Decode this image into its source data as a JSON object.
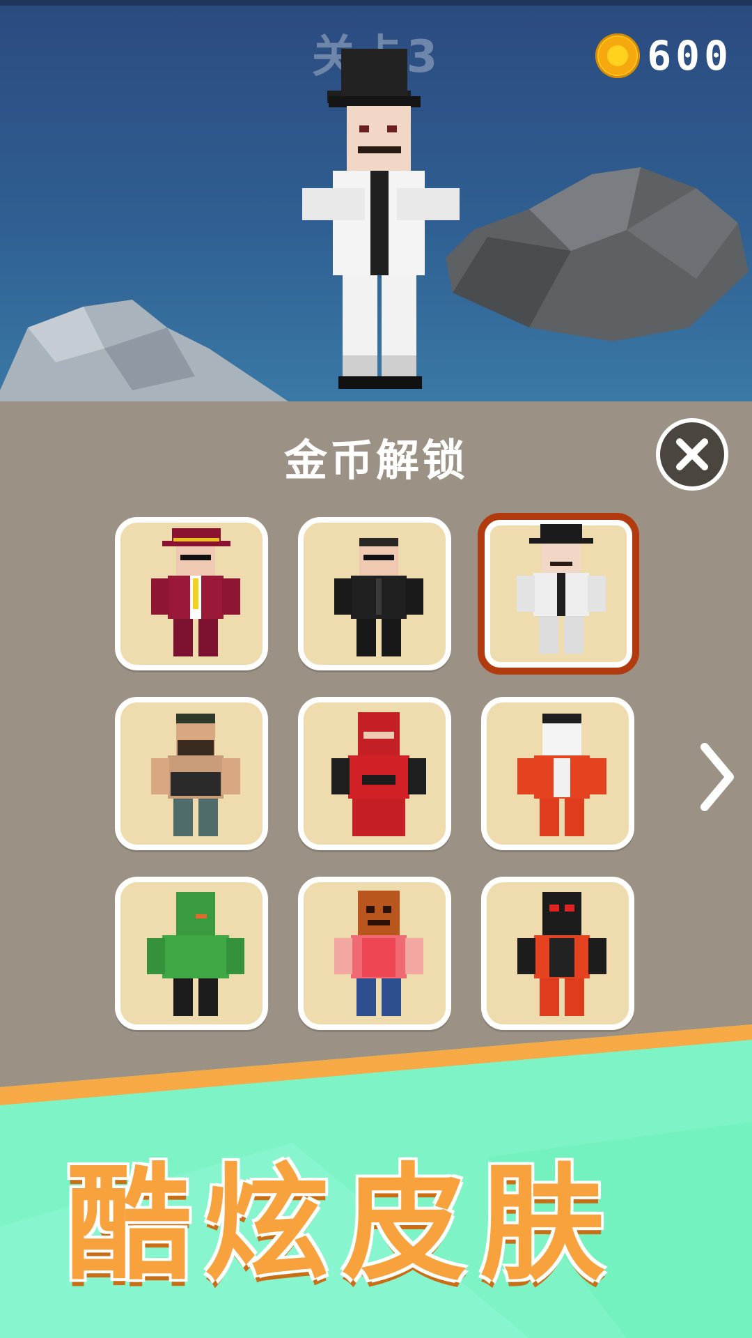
{
  "hud": {
    "level": "关卡3",
    "coins": "600"
  },
  "panel": {
    "title": "金币解锁"
  },
  "skins": [
    {
      "name": "gangster-red-suit",
      "selected": false
    },
    {
      "name": "agent-black-suit",
      "selected": false
    },
    {
      "name": "gentleman-white-suit",
      "selected": true
    },
    {
      "name": "commando-vest",
      "selected": false
    },
    {
      "name": "ninja-red",
      "selected": false
    },
    {
      "name": "masked-orange-suit",
      "selected": false
    },
    {
      "name": "zombie-green",
      "selected": false
    },
    {
      "name": "pumpkin-head",
      "selected": false
    },
    {
      "name": "skull-orange",
      "selected": false
    }
  ],
  "promo": {
    "text": "酷炫皮肤"
  },
  "colors": {
    "accent_selected": "#b13b0f",
    "panel_bg": "#9b9184",
    "card_bg": "#efdcae",
    "promo_text": "#f7a23c",
    "promo_bg": "#7ef4c6"
  },
  "icons": {
    "coin": "coin-icon",
    "close": "close-icon",
    "next": "chevron-right-icon"
  }
}
